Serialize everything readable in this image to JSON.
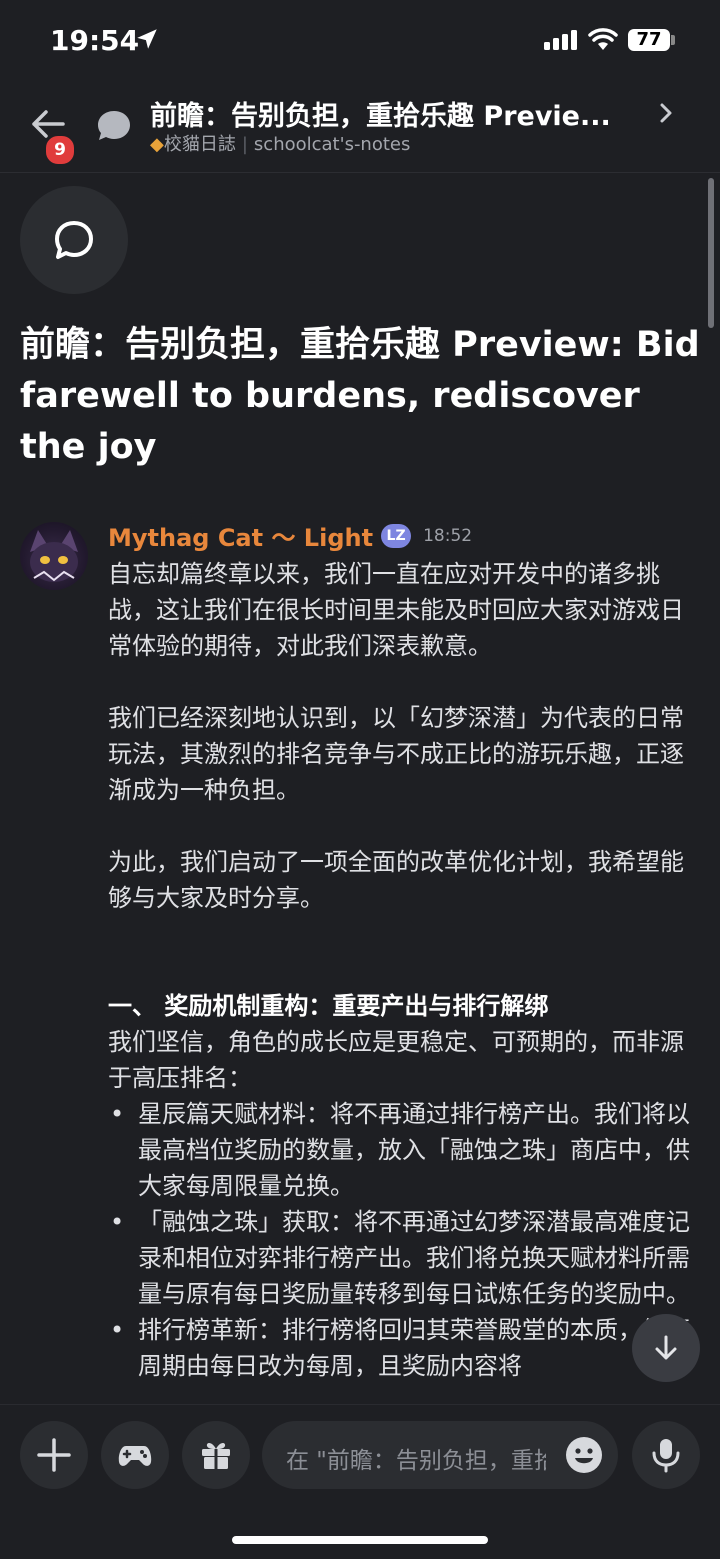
{
  "status_bar": {
    "time": "19:54",
    "battery": "77"
  },
  "header": {
    "back_badge": "9",
    "title": "前瞻：告别负担，重拾乐趣 Previe...",
    "server": "校貓日誌",
    "channel": "schoolcat's-notes"
  },
  "thread": {
    "title": "前瞻：告别负担，重拾乐趣 Preview: Bid farewell to burdens, rediscover the joy"
  },
  "message": {
    "author": "Mythag Cat ～ Light",
    "role_badge": "LZ",
    "timestamp": "18:52",
    "p1": "自忘却篇终章以来，我们一直在应对开发中的诸多挑战，这让我们在很长时间里未能及时回应大家对游戏日常体验的期待，对此我们深表歉意。",
    "p2": "我们已经深刻地认识到，以「幻梦深潜」为代表的日常玩法，其激烈的排名竞争与不成正比的游玩乐趣，正逐渐成为一种负担。",
    "p3": "为此，我们启动了一项全面的改革优化计划，我希望能够与大家及时分享。",
    "section1_heading": "一、 奖励机制重构：重要产出与排行解绑",
    "section1_intro": "我们坚信，角色的成长应是更稳定、可预期的，而非源于高压排名：",
    "bullets": [
      "星辰篇天赋材料：将不再通过排行榜产出。我们将以最高档位奖励的数量，放入「融蚀之珠」商店中，供大家每周限量兑换。",
      "「融蚀之珠」获取：将不再通过幻梦深潜最高难度记录和相位对弈排行榜产出。我们将兑换天赋材料所需量与原有每日奖励量转移到每日试炼任务的奖励中。",
      "排行榜革新：排行榜将回归其荣誉殿堂的本质，结算周期由每日改为每周，且奖励内容将"
    ]
  },
  "composer": {
    "placeholder": "在 \"前瞻：告别负担，重拾乐趣 Preview...\""
  }
}
